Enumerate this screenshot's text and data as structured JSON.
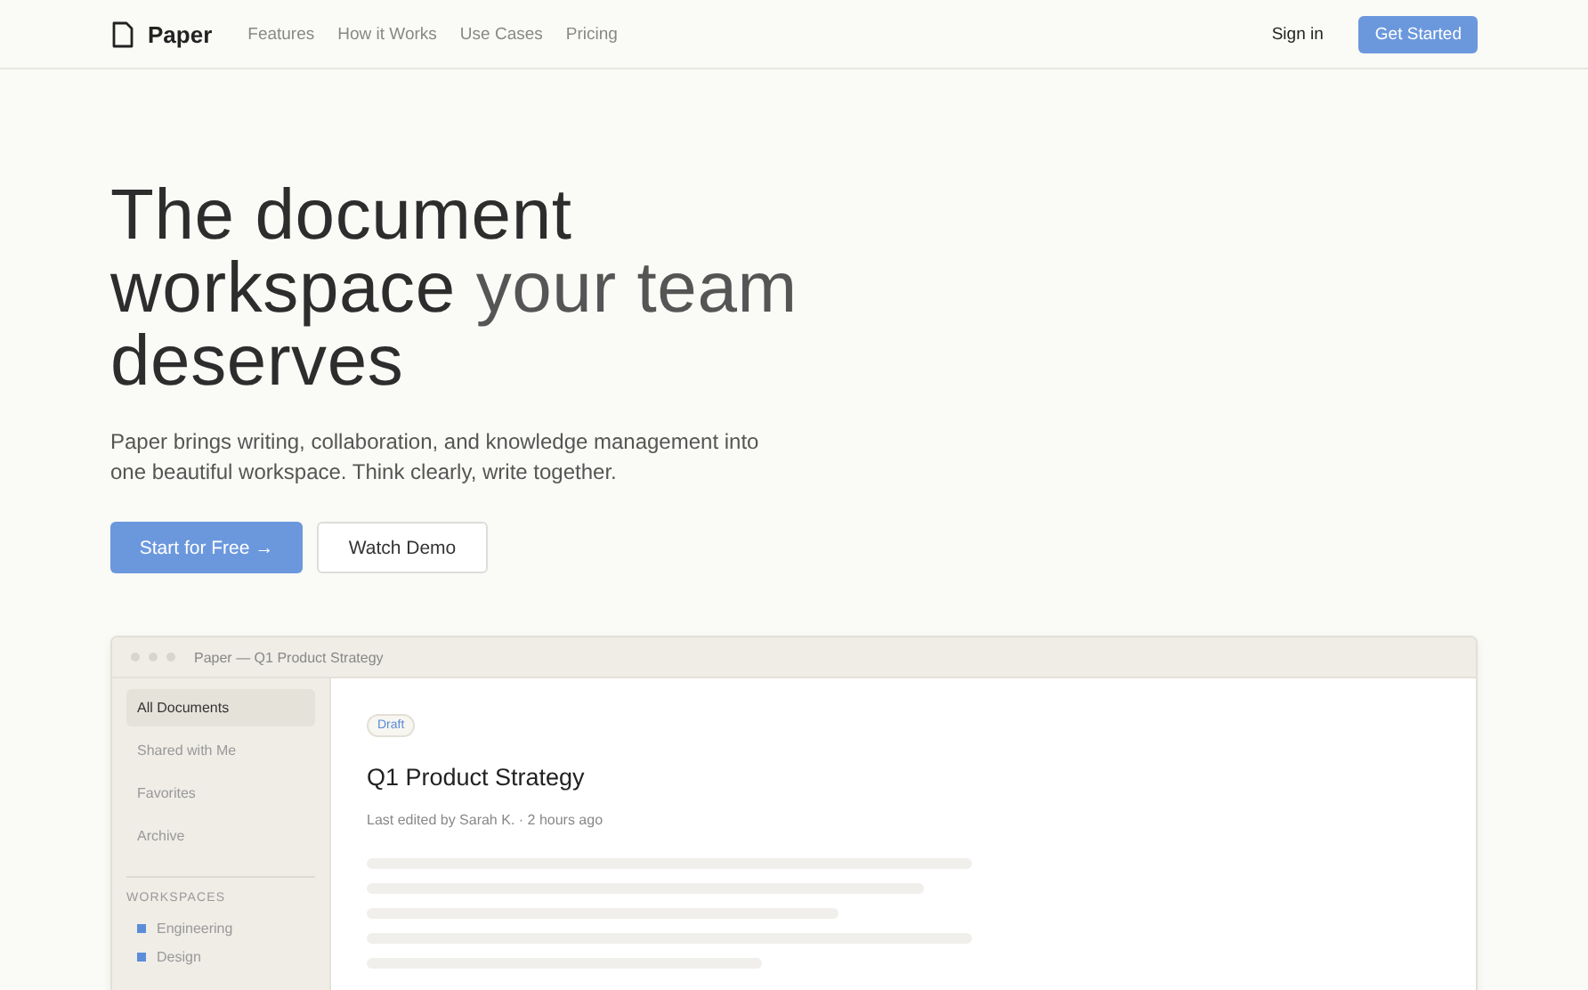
{
  "nav": {
    "brand": "Paper",
    "links": [
      "Features",
      "How it Works",
      "Use Cases",
      "Pricing"
    ],
    "sign_in": "Sign in",
    "cta": "Get Started"
  },
  "hero": {
    "headline": [
      {
        "text": "The document workspace ",
        "muted": false
      },
      {
        "text": "your team",
        "muted": true
      },
      {
        "text": " deserves",
        "muted": false
      }
    ],
    "subtitle": "Paper brings writing, collaboration, and knowledge management into one beautiful workspace. Think clearly, write together.",
    "primary_button": "Start for Free →",
    "secondary_button": "Watch Demo"
  },
  "preview": {
    "window_title": "Paper — Q1 Product Strategy",
    "sidebar_items": [
      {
        "label": "All Documents",
        "selected": true
      },
      {
        "label": "Shared with Me",
        "selected": false
      },
      {
        "label": "Favorites",
        "selected": false
      },
      {
        "label": "Archive",
        "selected": false
      }
    ],
    "workspaces_heading": "WORKSPACES",
    "workspaces": [
      {
        "label": "Engineering",
        "color": "#5b8dd9"
      },
      {
        "label": "Design",
        "color": "#5b8dd9"
      }
    ],
    "badge": "Draft",
    "doc_title": "Q1 Product Strategy",
    "meta": "Last edited by Sarah K. · 2 hours ago"
  }
}
